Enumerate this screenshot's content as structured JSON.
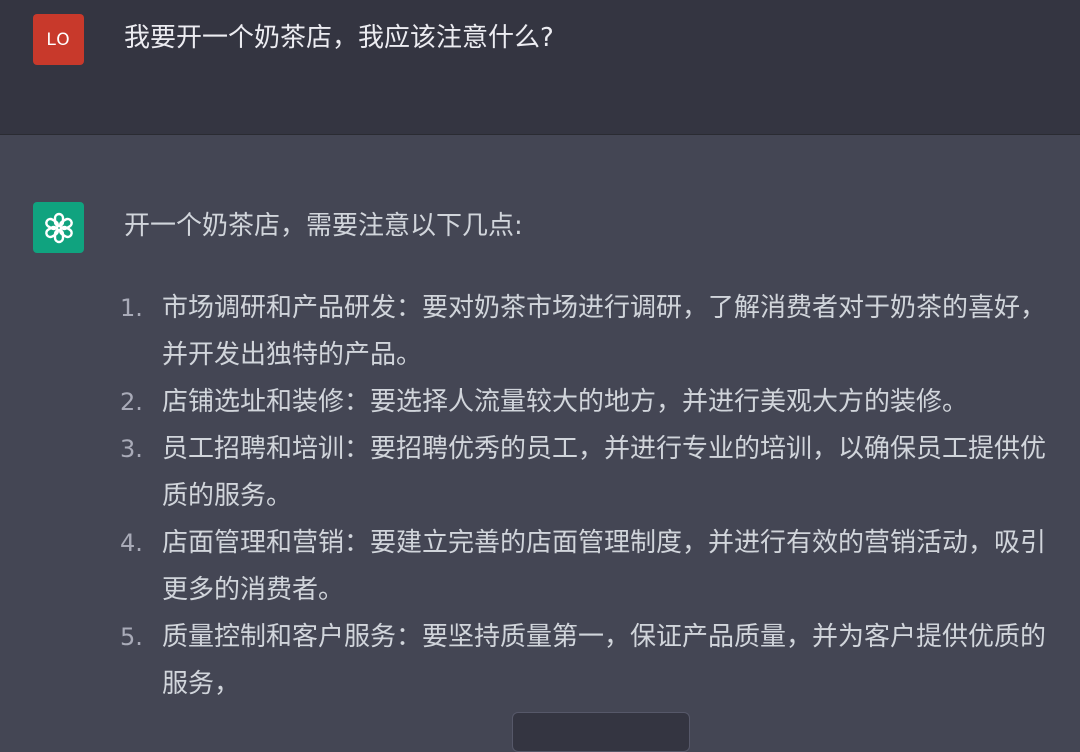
{
  "user": {
    "avatar_text": "LO",
    "message": "我要开一个奶茶店，我应该注意什么?"
  },
  "assistant": {
    "avatar_icon": "openai-logo-icon",
    "intro": "开一个奶茶店，需要注意以下几点:",
    "items": [
      {
        "num": "1.",
        "text": "市场调研和产品研发：要对奶茶市场进行调研，了解消费者对于奶茶的喜好，并开发出独特的产品。"
      },
      {
        "num": "2.",
        "text": "店铺选址和装修：要选择人流量较大的地方，并进行美观大方的装修。"
      },
      {
        "num": "3.",
        "text": "员工招聘和培训：要招聘优秀的员工，并进行专业的培训，以确保员工提供优质的服务。"
      },
      {
        "num": "4.",
        "text": "店面管理和营销：要建立完善的店面管理制度，并进行有效的营销活动，吸引更多的消费者。"
      },
      {
        "num": "5.",
        "text": "质量控制和客户服务：要坚持质量第一，保证产品质量，并为客户提供优质的服务，"
      }
    ]
  },
  "colors": {
    "user_bg": "#343541",
    "assistant_bg": "#444654",
    "user_avatar": "#c8392b",
    "bot_avatar": "#10a37f"
  }
}
